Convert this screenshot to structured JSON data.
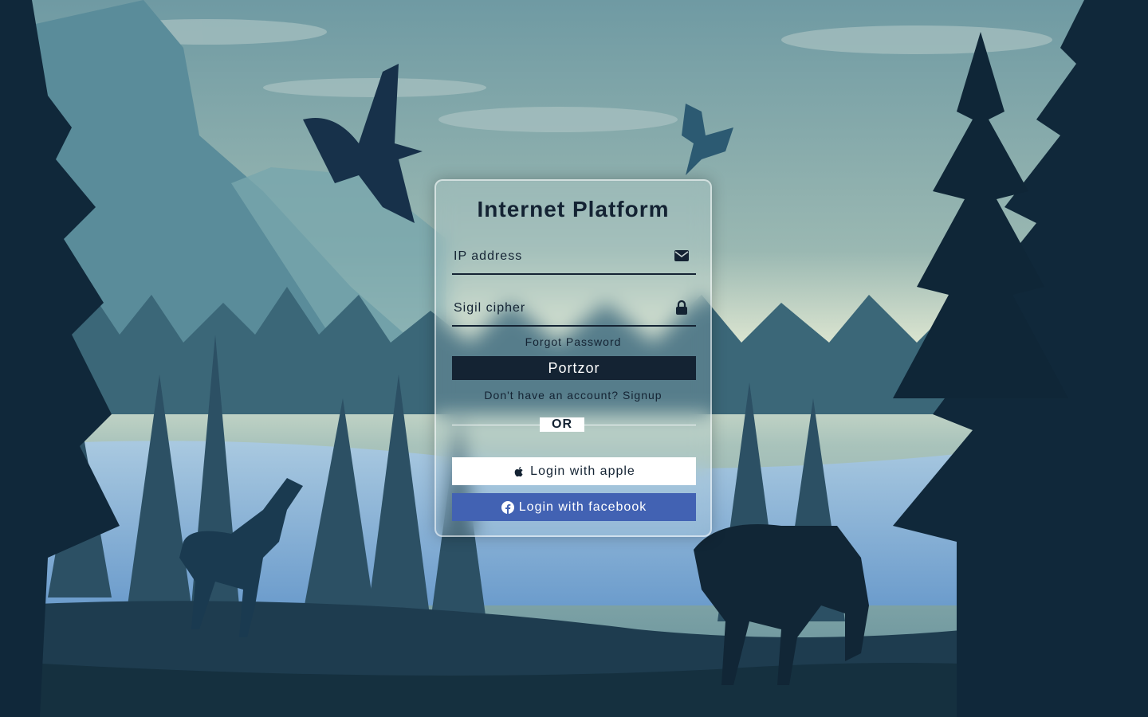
{
  "app": {
    "title": "Internet Platform"
  },
  "form": {
    "username": {
      "placeholder": "IP address",
      "value": "",
      "icon": "envelope-icon"
    },
    "password": {
      "placeholder": "Sigil cipher",
      "value": "",
      "icon": "lock-icon"
    },
    "forgot_label": "Forgot Password",
    "submit_label": "Portzor",
    "signup_text": "Don't have an account? Signup",
    "divider_label": "OR"
  },
  "social": {
    "apple": {
      "label": "Login with apple",
      "icon": "apple-icon"
    },
    "facebook": {
      "label": "Login with facebook",
      "icon": "facebook-icon"
    }
  },
  "colors": {
    "primary": "#142333",
    "facebook": "#4262b3",
    "sky": "#9ab6b4",
    "glow": "#e8eed8"
  }
}
